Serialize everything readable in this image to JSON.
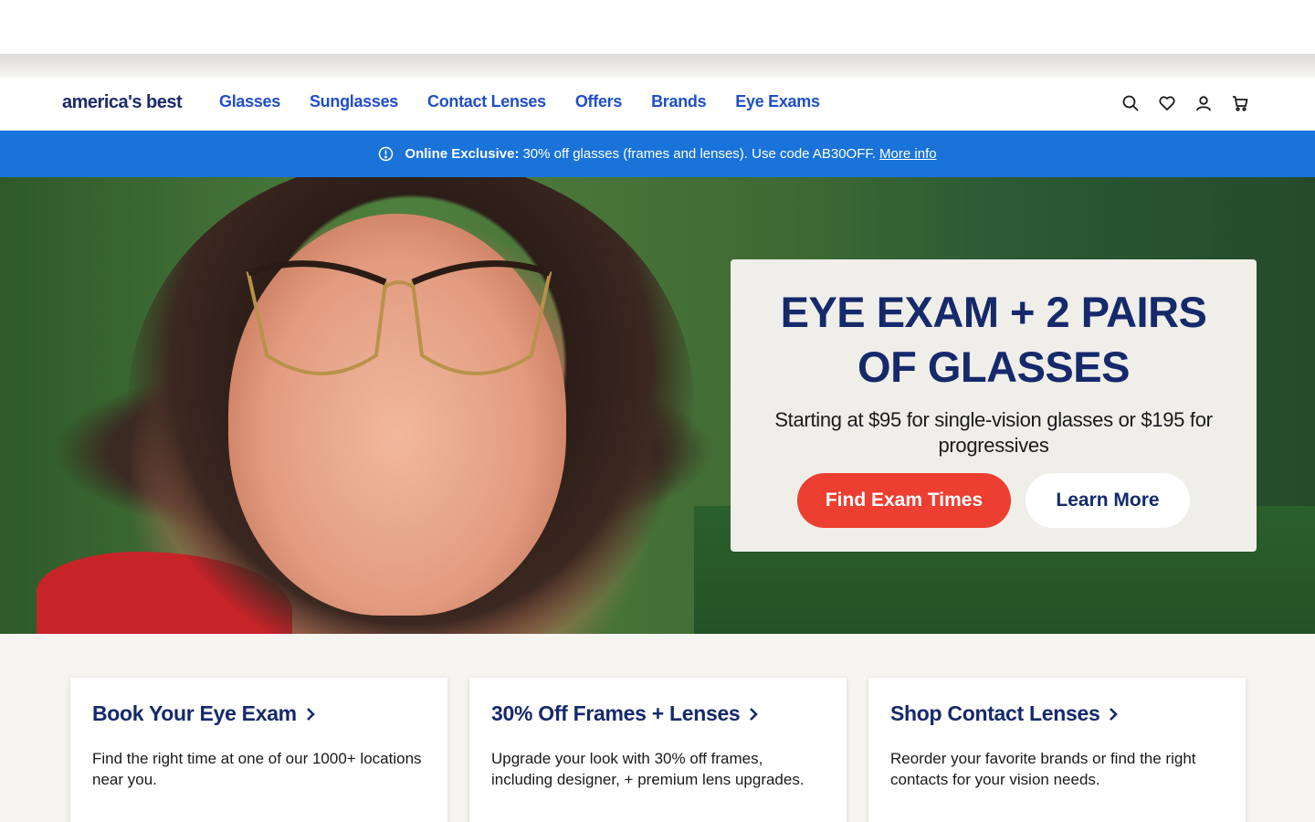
{
  "header": {
    "logo": "america's best",
    "nav": [
      "Glasses",
      "Sunglasses",
      "Contact Lenses",
      "Offers",
      "Brands",
      "Eye Exams"
    ],
    "icons": [
      "search-icon",
      "heart-icon",
      "account-icon",
      "cart-icon"
    ]
  },
  "promo": {
    "bold": "Online Exclusive:",
    "text": "30% off glasses (frames and lenses). Use code AB30OFF.",
    "link": "More info",
    "icon": "info-icon"
  },
  "hero": {
    "title": "EYE EXAM + 2 PAIRS OF GLASSES",
    "subtitle": "Starting at $95 for single-vision glasses or $195 for progressives",
    "primary_button": "Find Exam Times",
    "secondary_button": "Learn More"
  },
  "cards": [
    {
      "title": "Book Your Eye Exam",
      "text": "Find the right time at one of our 1000+ locations near you."
    },
    {
      "title": "30% Off Frames + Lenses",
      "text": "Upgrade your look with 30% off frames, including designer, + premium lens upgrades."
    },
    {
      "title": "Shop Contact Lenses",
      "text": "Reorder your favorite brands or find the right contacts for your vision needs."
    }
  ],
  "colors": {
    "nav_blue": "#1f4fc8",
    "navy": "#15296b",
    "promo_blue": "#1a73d9",
    "cta_red": "#ec3e31"
  }
}
